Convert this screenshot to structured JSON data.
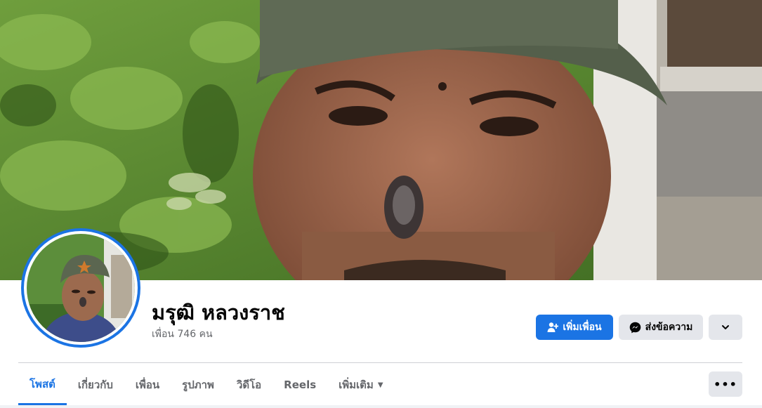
{
  "profile": {
    "name": "มรุฒิ หลวงราช",
    "friends_text": "เพื่อน 746 คน"
  },
  "actions": {
    "add_friend": "เพิ่มเพื่อน",
    "message": "ส่งข้อความ"
  },
  "tabs": [
    {
      "label": "โพสต์",
      "active": true
    },
    {
      "label": "เกี่ยวกับ",
      "active": false
    },
    {
      "label": "เพื่อน",
      "active": false
    },
    {
      "label": "รูปภาพ",
      "active": false
    },
    {
      "label": "วิดีโอ",
      "active": false
    },
    {
      "label": "Reels",
      "active": false
    },
    {
      "label": "เพิ่มเติม",
      "active": false
    }
  ],
  "more_menu_glyph": "•••",
  "colors": {
    "accent": "#1b74e4",
    "secondary_button": "#e4e6eb",
    "muted_text": "#65676b"
  },
  "icons": [
    "add-friend-icon",
    "messenger-icon",
    "chevron-down-icon",
    "caret-down-icon",
    "more-dots-icon"
  ]
}
